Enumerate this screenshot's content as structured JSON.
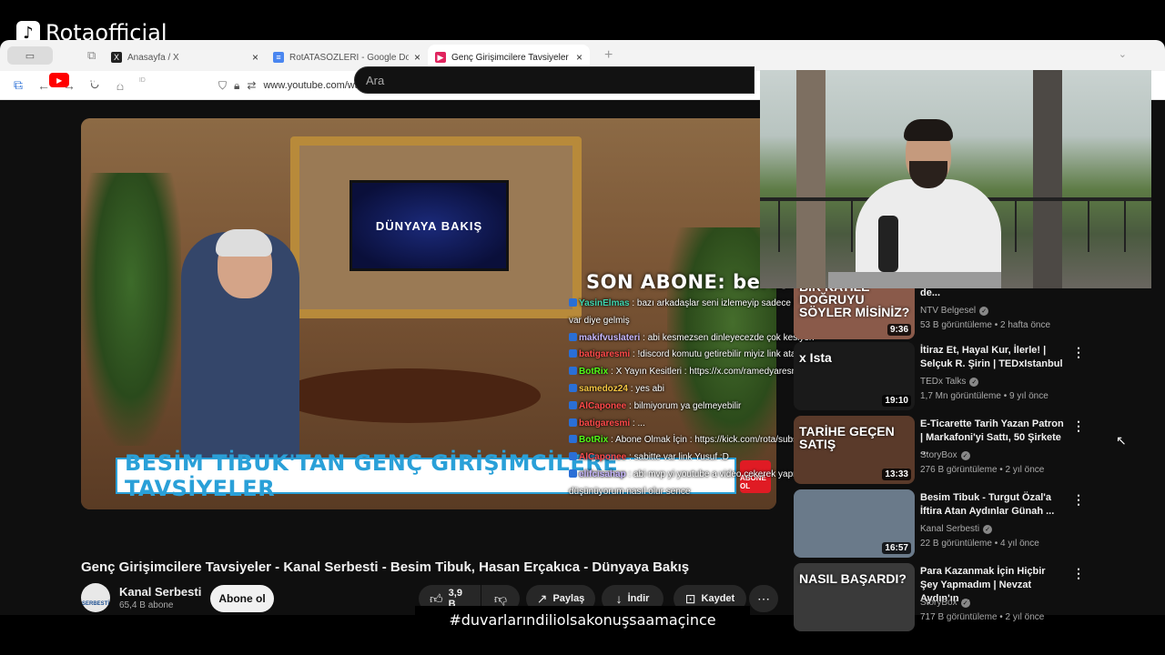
{
  "watermark": {
    "text": "Rotaofficial"
  },
  "browser": {
    "tabs": [
      {
        "label": "Anasayfa / X",
        "icon": "x-logo-icon",
        "active": false
      },
      {
        "label": "RotATASÖZLERİ - Google Dokü",
        "icon": "google-docs-icon",
        "active": false
      },
      {
        "label": "Genç Girişimcilere Tavsiyeler - K",
        "icon": "youtube-icon",
        "active": true
      }
    ],
    "url": "www.youtube.com/watch?v=NEUGcjCxUhU"
  },
  "youtube": {
    "logo": "YouTube",
    "region": "ID",
    "search_placeholder": "Ara"
  },
  "video": {
    "tv_text": "DÜNYAYA BAKIŞ",
    "banner": "BESİM TİBUK'TAN GENÇ GİRİŞİMCİLERE TAVSİYELER",
    "abone_badge": "ABONE OL",
    "title": "Genç Girişimcilere Tavsiyeler - Kanal Serbesti - Besim Tibuk, Hasan Erçakıca - Dünyaya Bakış",
    "channel_name": "Kanal Serbesti",
    "subscribers": "65,4 B abone",
    "subscribe_label": "Abone ol",
    "likes": "3,9 B",
    "share_label": "Paylaş",
    "download_label": "İndir",
    "save_label": "Kaydet"
  },
  "overlay": {
    "last_sub": "SON ABONE: beriodas",
    "chat": [
      {
        "user": "YasinElmas",
        "text": ": bazı arkadaşlar seni izlemeyip sadece çok yazılımcı",
        "color": "#3fd6b0"
      },
      {
        "user": "",
        "text": "var diye gelmiş",
        "color": "#ffffff"
      },
      {
        "user": "makifvuslateri",
        "text": ": abi kesmezsen dinleyecezde çok kesiyon",
        "color": "#c8b8ff"
      },
      {
        "user": "batigaresmi",
        "text": ": !discord komutu getirebilir miyiz link atan bot",
        "color": "#ff4a4a"
      },
      {
        "user": "BotRix",
        "text": ": X Yayın Kesitleri : https://x.com/ramedyaresmi",
        "color": "#53fc18"
      },
      {
        "user": "samedoz24",
        "text": ": yes abi",
        "color": "#f5c542"
      },
      {
        "user": "AlCaponee",
        "text": ": bilmiyorum ya gelmeyebilir",
        "color": "#ff4a4a"
      },
      {
        "user": "batigaresmi",
        "text": ": ...",
        "color": "#ff4a4a"
      },
      {
        "user": "BotRix",
        "text": ": Abone Olmak İçin : https://kick.com/rota/subscribe",
        "color": "#53fc18"
      },
      {
        "user": "AlCaponee",
        "text": ": sabitte var link Yusuf :D",
        "color": "#ff4a4a"
      },
      {
        "user": "elifcisahap",
        "text": ": abi mvp yi youtube a video çekerek yapmayı",
        "color": "#c8b8ff"
      },
      {
        "user": "",
        "text": "düşünüyorum nasıl olur sence",
        "color": "#ffffff"
      }
    ]
  },
  "sidebar": [
    {
      "title": "İzin Verir? Todinna Kuçurladi de...",
      "channel": "NTV Belgesel",
      "meta": "53 B görüntüleme • 2 hafta önce",
      "duration": "9:36",
      "caption": "BİR KATİLE DOĞRUYU SÖYLER MİSİNİZ?",
      "thumb_color": "#8a5a4a"
    },
    {
      "title": "İtiraz Et, Hayal Kur, İlerle! | Selçuk R. Şirin | TEDxIstanbul",
      "channel": "TEDx Talks",
      "meta": "1,7 Mn görüntüleme • 9 yıl önce",
      "duration": "19:10",
      "caption": "x Ista",
      "thumb_color": "#1a1a1a"
    },
    {
      "title": "E-Ticarette Tarih Yazan Patron | Markafoni'yi Sattı, 50 Şirkete ...",
      "channel": "StoryBox",
      "meta": "276 B görüntüleme • 2 yıl önce",
      "duration": "13:33",
      "caption": "TARİHE GEÇEN SATIŞ",
      "thumb_color": "#5a3a2a"
    },
    {
      "title": "Besim Tibuk - Turgut Özal'a İftira Atan Aydınlar Günah ...",
      "channel": "Kanal Serbesti",
      "meta": "22 B görüntüleme • 4 yıl önce",
      "duration": "16:57",
      "caption": "",
      "thumb_color": "#6a7a8a"
    },
    {
      "title": "Para Kazanmak İçin Hiçbir Şey Yapmadım | Nevzat Aydın'ın ...",
      "channel": "StoryBox",
      "meta": "717 B görüntüleme • 2 yıl önce",
      "duration": "",
      "caption": "NASIL BAŞARDI?",
      "thumb_color": "#3a3a3a"
    }
  ],
  "hashtag": "#duvarlarındiliolsakonuşsaamaçince"
}
